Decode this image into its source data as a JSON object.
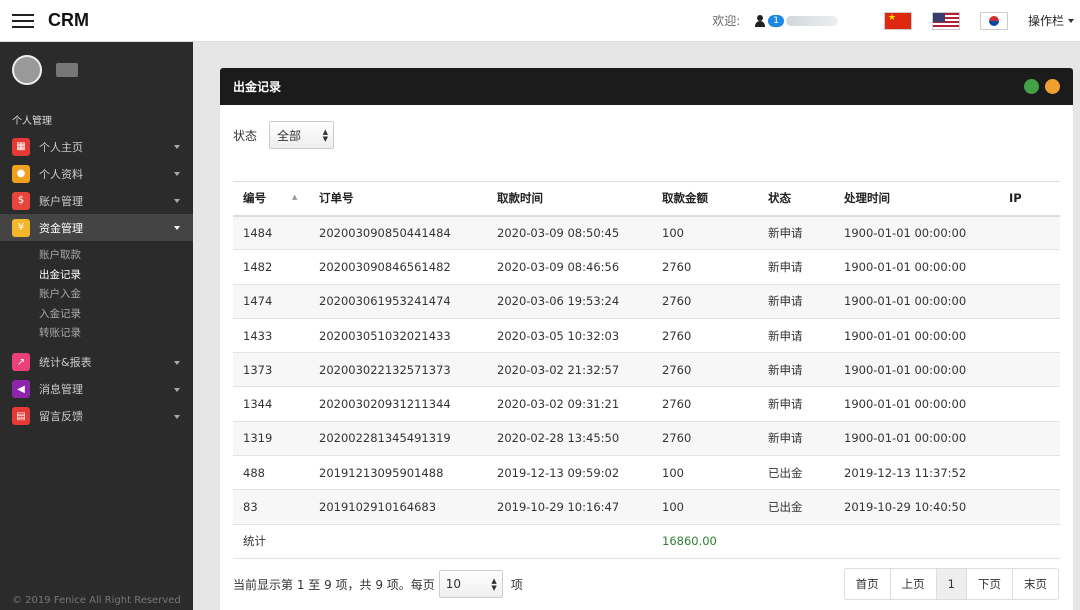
{
  "topbar": {
    "brand": "CRM",
    "welcome": "欢迎:",
    "user_badge": "1",
    "ops_menu": "操作栏",
    "icons": [
      "menu-icon",
      "user-icon",
      "flag-cn-icon",
      "flag-us-icon",
      "flag-kr-icon"
    ]
  },
  "sidebar": {
    "section": "个人管理",
    "items": [
      {
        "label": "个人主页",
        "icon": "home-icon"
      },
      {
        "label": "个人资料",
        "icon": "profile-icon"
      },
      {
        "label": "账户管理",
        "icon": "account-icon"
      },
      {
        "label": "资金管理",
        "icon": "yen-icon"
      },
      {
        "label": "统计&报表",
        "icon": "chart-icon"
      },
      {
        "label": "消息管理",
        "icon": "megaphone-icon"
      },
      {
        "label": "留言反馈",
        "icon": "feedback-icon"
      }
    ],
    "submenu": [
      "账户取款",
      "出金记录",
      "账户入金",
      "入金记录",
      "转账记录"
    ],
    "footer": "© 2019 Fenice All Right Reserved"
  },
  "panel": {
    "title": "出金记录",
    "filter_label": "状态",
    "filter_value": "全部"
  },
  "table": {
    "headers": [
      "编号",
      "订单号",
      "取款时间",
      "取款金额",
      "状态",
      "处理时间",
      "IP"
    ],
    "rows": [
      [
        "1484",
        "202003090850441484",
        "2020-03-09 08:50:45",
        "100",
        "新申请",
        "1900-01-01 00:00:00",
        ""
      ],
      [
        "1482",
        "202003090846561482",
        "2020-03-09 08:46:56",
        "2760",
        "新申请",
        "1900-01-01 00:00:00",
        ""
      ],
      [
        "1474",
        "202003061953241474",
        "2020-03-06 19:53:24",
        "2760",
        "新申请",
        "1900-01-01 00:00:00",
        ""
      ],
      [
        "1433",
        "202003051032021433",
        "2020-03-05 10:32:03",
        "2760",
        "新申请",
        "1900-01-01 00:00:00",
        ""
      ],
      [
        "1373",
        "202003022132571373",
        "2020-03-02 21:32:57",
        "2760",
        "新申请",
        "1900-01-01 00:00:00",
        ""
      ],
      [
        "1344",
        "202003020931211344",
        "2020-03-02 09:31:21",
        "2760",
        "新申请",
        "1900-01-01 00:00:00",
        ""
      ],
      [
        "1319",
        "202002281345491319",
        "2020-02-28 13:45:50",
        "2760",
        "新申请",
        "1900-01-01 00:00:00",
        ""
      ],
      [
        "488",
        "20191213095901488",
        "2019-12-13 09:59:02",
        "100",
        "已出金",
        "2019-12-13 11:37:52",
        ""
      ],
      [
        "83",
        "2019102910164683",
        "2019-10-29 10:16:47",
        "100",
        "已出金",
        "2019-10-29 10:40:50",
        ""
      ]
    ],
    "total_label": "统计",
    "total_value": "16860.00"
  },
  "footer": {
    "info_text": "当前显示第 1 至 9 项，共 9 项。每页",
    "page_size": "10",
    "unit": "项",
    "pager": [
      "首页",
      "上页",
      "1",
      "下页",
      "末页"
    ]
  },
  "colors": {
    "sidebar_bg": "#2b2b2b",
    "panel_header_bg": "#1b1b1b",
    "total_green": "#2e7d32"
  }
}
